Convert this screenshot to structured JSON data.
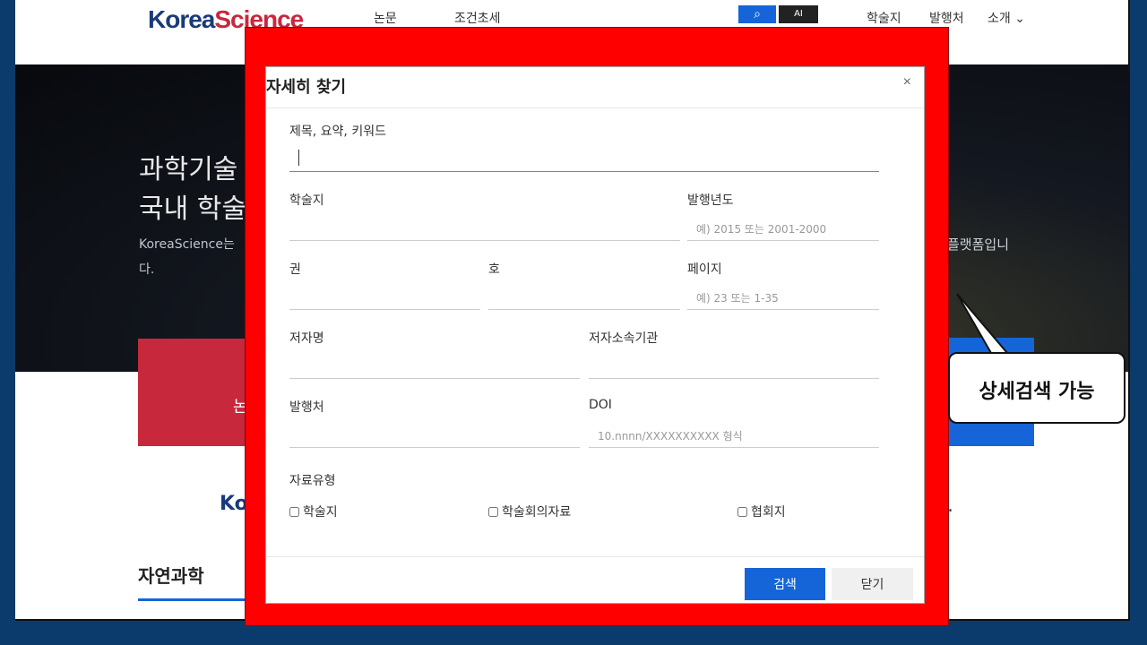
{
  "header": {
    "logo_main": "Korea",
    "logo_accent": "Science",
    "tab_1": "논문",
    "tab_2": "조건초세",
    "search_icon": "search-icon",
    "dark_button": "AI",
    "link_1": "학술지",
    "link_2": "발행처",
    "link_3": "소개 ⌄"
  },
  "hero": {
    "title_line1": "과학기술",
    "title_line2": "국내 학술",
    "desc_line1": "KoreaScience는",
    "desc_line2": "다.",
    "desc_right": "플랫폼입니"
  },
  "cards": {
    "red_label": "논"
  },
  "section": {
    "ko_text": "Ko",
    "dot_text": ".",
    "nat_sci": "자연과학"
  },
  "modal": {
    "title": "자세히 찾기",
    "close": "×",
    "keyword_label": "제목, 요약, 키워드",
    "journal_label": "학술지",
    "year_label": "발행년도",
    "year_placeholder": "예) 2015 또는 2001-2000",
    "volume_label": "권",
    "issue_label": "호",
    "page_label": "페이지",
    "page_placeholder": "예) 23 또는 1-35",
    "author_label": "저자명",
    "affiliation_label": "저자소속기관",
    "publisher_label": "발행처",
    "doi_label": "DOI",
    "doi_placeholder": "10.nnnn/XXXXXXXXXX 형식",
    "type_label": "자료유형",
    "types": [
      "학술지",
      "학술회의자료",
      "협회지"
    ],
    "search_button": "검색",
    "close_button": "닫기"
  },
  "callout": {
    "text": "상세검색 가능"
  },
  "colors": {
    "highlight": "#ff0000",
    "primary": "#1565d8",
    "brand_red": "#c8283c"
  }
}
